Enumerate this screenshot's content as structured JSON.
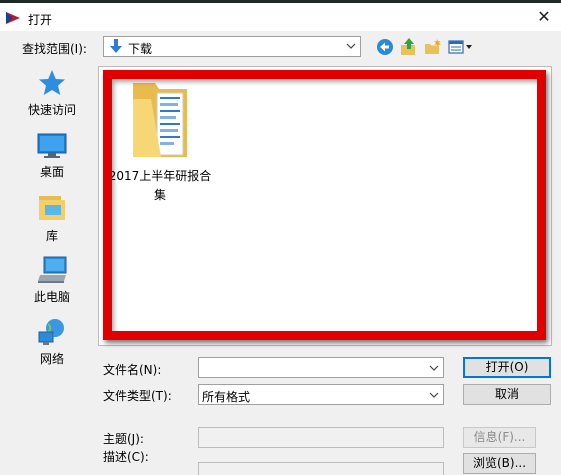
{
  "window": {
    "title": "打开",
    "close_glyph": "✕"
  },
  "lookin": {
    "label": "查找范围(I):",
    "value": "下载"
  },
  "toolbar": {
    "back_icon": "back-arrow-icon",
    "up_icon": "up-folder-icon",
    "new_folder_icon": "new-folder-icon",
    "view_menu_icon": "view-menu-icon"
  },
  "sidebar": {
    "items": [
      {
        "label": "快速访问",
        "icon": "star-icon"
      },
      {
        "label": "桌面",
        "icon": "desktop-icon"
      },
      {
        "label": "库",
        "icon": "library-icon"
      },
      {
        "label": "此电脑",
        "icon": "computer-icon"
      },
      {
        "label": "网络",
        "icon": "network-icon"
      }
    ]
  },
  "files": [
    {
      "name": "2017上半年研报合集",
      "type": "folder"
    }
  ],
  "form": {
    "filename_label": "文件名(N):",
    "filename_value": "",
    "filetype_label": "文件类型(T):",
    "filetype_value": "所有格式",
    "subject_label": "主题(J):",
    "subject_value": "",
    "description_label": "描述(C):"
  },
  "buttons": {
    "open": "打开(O)",
    "cancel": "取消",
    "info": "信息(F)...",
    "browse": "浏览(B)..."
  },
  "colors": {
    "highlight_frame": "#e10000",
    "dialog_bg": "#f0f0f0",
    "accent": "#0078d7",
    "folder": "#f7d674"
  }
}
